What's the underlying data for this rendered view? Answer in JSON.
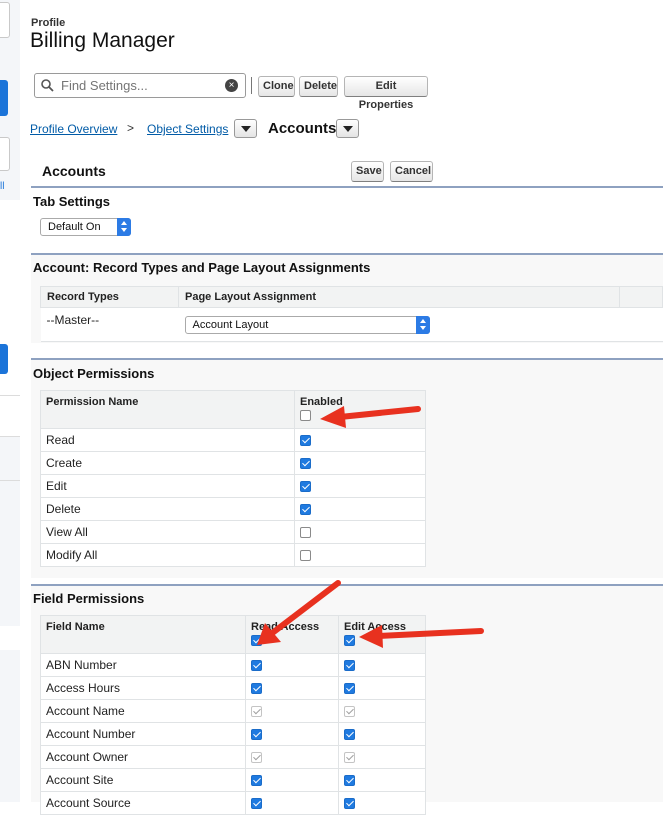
{
  "header": {
    "profile_label": "Profile",
    "title": "Billing Manager"
  },
  "toolbar": {
    "search_placeholder": "Find Settings...",
    "clone_label": "Clone",
    "delete_label": "Delete",
    "edit_properties_label": "Edit Properties"
  },
  "breadcrumb": {
    "profile_overview": "Profile Overview",
    "separator": ">",
    "object_settings": "Object Settings",
    "current": "Accounts"
  },
  "object_header": {
    "title": "Accounts",
    "save_label": "Save",
    "cancel_label": "Cancel"
  },
  "tab_settings": {
    "title": "Tab Settings",
    "selected": "Default On"
  },
  "record_types": {
    "title": "Account: Record Types and Page Layout Assignments",
    "columns": [
      "Record Types",
      "Page Layout Assignment"
    ],
    "rows": [
      {
        "record_type": "--Master--",
        "layout": "Account Layout"
      }
    ]
  },
  "object_permissions": {
    "title": "Object Permissions",
    "columns": [
      "Permission Name",
      "Enabled"
    ],
    "header_checked": false,
    "rows": [
      {
        "name": "Read",
        "enabled": "on"
      },
      {
        "name": "Create",
        "enabled": "on"
      },
      {
        "name": "Edit",
        "enabled": "on"
      },
      {
        "name": "Delete",
        "enabled": "on"
      },
      {
        "name": "View All",
        "enabled": "off"
      },
      {
        "name": "Modify All",
        "enabled": "off"
      }
    ]
  },
  "field_permissions": {
    "title": "Field Permissions",
    "columns": [
      "Field Name",
      "Read Access",
      "Edit Access"
    ],
    "header_read_checked": true,
    "header_edit_checked": true,
    "rows": [
      {
        "name": "ABN Number",
        "read": "on",
        "edit": "on"
      },
      {
        "name": "Access Hours",
        "read": "on",
        "edit": "on"
      },
      {
        "name": "Account Name",
        "read": "dis",
        "edit": "dis"
      },
      {
        "name": "Account Number",
        "read": "on",
        "edit": "on"
      },
      {
        "name": "Account Owner",
        "read": "dis",
        "edit": "dis"
      },
      {
        "name": "Account Site",
        "read": "on",
        "edit": "on"
      },
      {
        "name": "Account Source",
        "read": "on",
        "edit": "on"
      }
    ]
  },
  "colors": {
    "link": "#015ba7",
    "checkbox": "#1f7ae0",
    "section_bar": "#8ea1c0",
    "annotation_arrow": "#e8311f"
  }
}
